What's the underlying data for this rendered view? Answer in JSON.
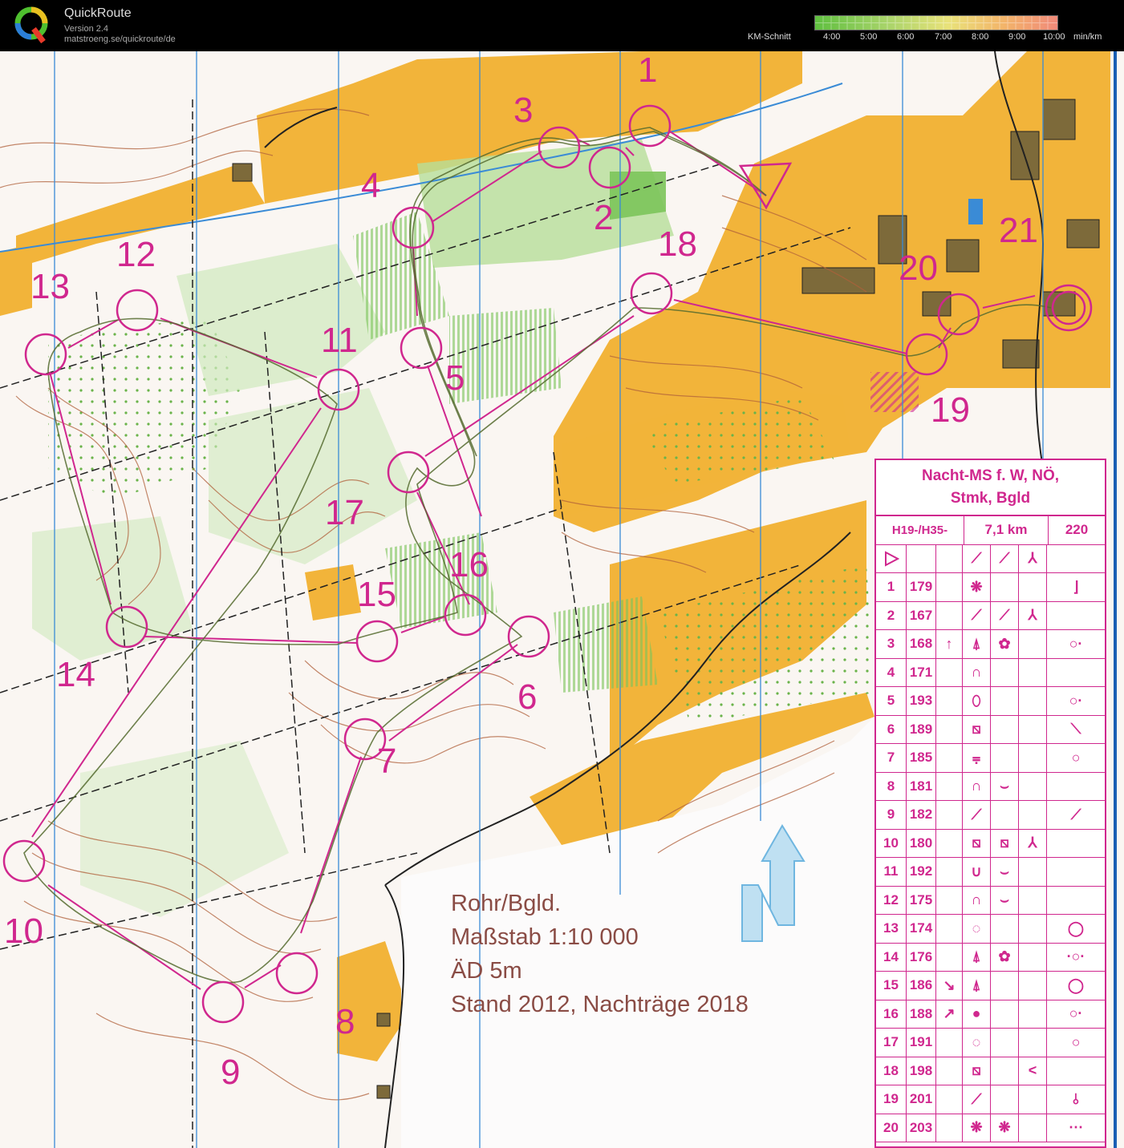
{
  "app": {
    "title": "QuickRoute",
    "version": "Version 2.4",
    "url": "matstroeng.se/quickroute/de",
    "logo_icon": "quickroute-q-logo"
  },
  "pace_legend": {
    "label": "KM-Schnitt",
    "ticks": [
      "4:00",
      "5:00",
      "6:00",
      "7:00",
      "8:00",
      "9:00",
      "10:00",
      "min/km"
    ],
    "colors": [
      "#5fbf3f",
      "#a9d46a",
      "#e9e27a",
      "#f3b46a",
      "#f08a7a"
    ]
  },
  "map": {
    "info_lines": [
      "Rohr/Bgld.",
      "Maßstab 1:10 000",
      "ÄD 5m",
      "Stand 2012, Nachträge 2018"
    ],
    "control_labels": [
      "1",
      "2",
      "3",
      "4",
      "5",
      "6",
      "7",
      "8",
      "9",
      "10",
      "11",
      "12",
      "13",
      "14",
      "15",
      "16",
      "17",
      "18",
      "19",
      "20",
      "21"
    ],
    "colors": {
      "course": "#d0278e",
      "open": "#f2b43a",
      "forest": "#7cc45a",
      "contour": "#b0603a",
      "water": "#3a8bd6"
    },
    "north_arrow_icon": "north-arrow-icon"
  },
  "control_descriptions": {
    "title_line1": "Nacht-MS f. W, NÖ,",
    "title_line2": "Stmk, Bgld",
    "header": {
      "classes": "H19-/H35-",
      "length": "7,1 km",
      "climb": "220"
    },
    "start_icon": "start-triangle-icon",
    "rows": [
      {
        "n": "1",
        "code": "179",
        "f1": "",
        "f2": "❋",
        "f3": "",
        "f4": "",
        "f5": "⌋"
      },
      {
        "n": "2",
        "code": "167",
        "f1": "",
        "f2": "⟋",
        "f3": "⟋",
        "f4": "⅄",
        "f5": ""
      },
      {
        "n": "3",
        "code": "168",
        "f1": "↑",
        "f2": "⍋",
        "f3": "✿",
        "f4": "",
        "f5": "○·"
      },
      {
        "n": "4",
        "code": "171",
        "f1": "",
        "f2": "∩",
        "f3": "",
        "f4": "",
        "f5": ""
      },
      {
        "n": "5",
        "code": "193",
        "f1": "",
        "f2": "⬯",
        "f3": "",
        "f4": "",
        "f5": "○·"
      },
      {
        "n": "6",
        "code": "189",
        "f1": "",
        "f2": "⧅",
        "f3": "",
        "f4": "",
        "f5": "⟍"
      },
      {
        "n": "7",
        "code": "185",
        "f1": "",
        "f2": "⩦",
        "f3": "",
        "f4": "",
        "f5": "○"
      },
      {
        "n": "8",
        "code": "181",
        "f1": "",
        "f2": "∩",
        "f3": "⌣",
        "f4": "",
        "f5": ""
      },
      {
        "n": "9",
        "code": "182",
        "f1": "",
        "f2": "⟋",
        "f3": "",
        "f4": "",
        "f5": "⟋"
      },
      {
        "n": "10",
        "code": "180",
        "f1": "",
        "f2": "⧅",
        "f3": "⧅",
        "f4": "⅄",
        "f5": ""
      },
      {
        "n": "11",
        "code": "192",
        "f1": "",
        "f2": "∪",
        "f3": "⌣",
        "f4": "",
        "f5": ""
      },
      {
        "n": "12",
        "code": "175",
        "f1": "",
        "f2": "∩",
        "f3": "⌣",
        "f4": "",
        "f5": ""
      },
      {
        "n": "13",
        "code": "174",
        "f1": "",
        "f2": "◌",
        "f3": "",
        "f4": "",
        "f5": "◯"
      },
      {
        "n": "14",
        "code": "176",
        "f1": "",
        "f2": "⍋",
        "f3": "✿",
        "f4": "",
        "f5": "·○·"
      },
      {
        "n": "15",
        "code": "186",
        "f1": "↘",
        "f2": "⍋",
        "f3": "",
        "f4": "",
        "f5": "◯"
      },
      {
        "n": "16",
        "code": "188",
        "f1": "↗",
        "f2": "●",
        "f3": "",
        "f4": "",
        "f5": "○·"
      },
      {
        "n": "17",
        "code": "191",
        "f1": "",
        "f2": "◌",
        "f3": "",
        "f4": "",
        "f5": "○"
      },
      {
        "n": "18",
        "code": "198",
        "f1": "",
        "f2": "⧅",
        "f3": "",
        "f4": "<",
        "f5": ""
      },
      {
        "n": "19",
        "code": "201",
        "f1": "",
        "f2": "⟋",
        "f3": "",
        "f4": "",
        "f5": "⫰"
      },
      {
        "n": "20",
        "code": "203",
        "f1": "",
        "f2": "❋",
        "f3": "❋",
        "f4": "",
        "f5": "⋯"
      }
    ]
  }
}
